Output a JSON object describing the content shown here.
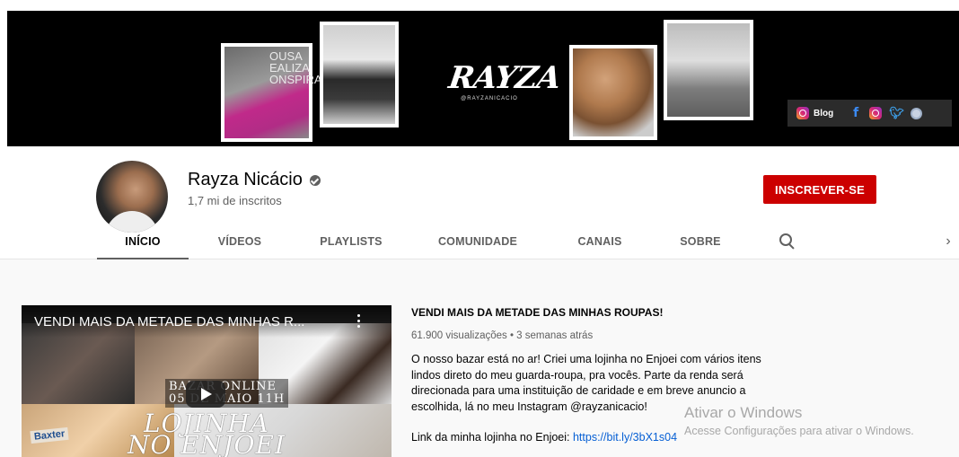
{
  "banner": {
    "brand_logo": "RAYZA",
    "brand_handle": "@RAYZANICACIO",
    "photo1_overlay": "OUSA\nEALIZA\nONSPIRAC",
    "links": [
      {
        "label": "Blog",
        "icon": "instagram-icon"
      },
      {
        "label": "",
        "icon": "facebook-icon"
      },
      {
        "label": "",
        "icon": "instagram-icon"
      },
      {
        "label": "",
        "icon": "twitter-icon"
      },
      {
        "label": "",
        "icon": "globe-icon"
      }
    ]
  },
  "channel": {
    "name": "Rayza Nicácio",
    "subscribers": "1,7 mi de inscritos",
    "subscribe_label": "INSCREVER-SE",
    "subscribe_color": "#cc0000"
  },
  "tabs": [
    {
      "label": "INÍCIO",
      "active": true
    },
    {
      "label": "VÍDEOS",
      "active": false
    },
    {
      "label": "PLAYLISTS",
      "active": false
    },
    {
      "label": "COMUNIDADE",
      "active": false
    },
    {
      "label": "CANAIS",
      "active": false
    },
    {
      "label": "SOBRE",
      "active": false
    }
  ],
  "tabs_next": "›",
  "featured": {
    "overlay_title": "VENDI MAIS DA METADE DAS MINHAS R...",
    "thumb_bazar": "BAZAR ONLINE\n05 DE MAIO 11H",
    "thumb_lojinha": "LOJINHA\nNO ENJOEI",
    "thumb_box": "Baxter",
    "title": "VENDI MAIS DA METADE DAS MINHAS ROUPAS!",
    "meta": "61.900 visualizações • 3 semanas atrás",
    "description": "O nosso bazar está no ar! Criei uma lojinha no Enjoei com vários itens lindos direto do meu guarda-roupa, pra vocês. Parte da renda será direcionada para uma instituição de caridade e em breve anuncio a escolhida, lá no meu Instagram @rayzanicacio!",
    "link_prefix": "Link da minha lojinha no Enjoei: ",
    "link_url": "https://bit.ly/3bX1s04"
  },
  "watermark": {
    "line1": "Ativar o Windows",
    "line2": "Acesse Configurações para ativar o Windows."
  }
}
